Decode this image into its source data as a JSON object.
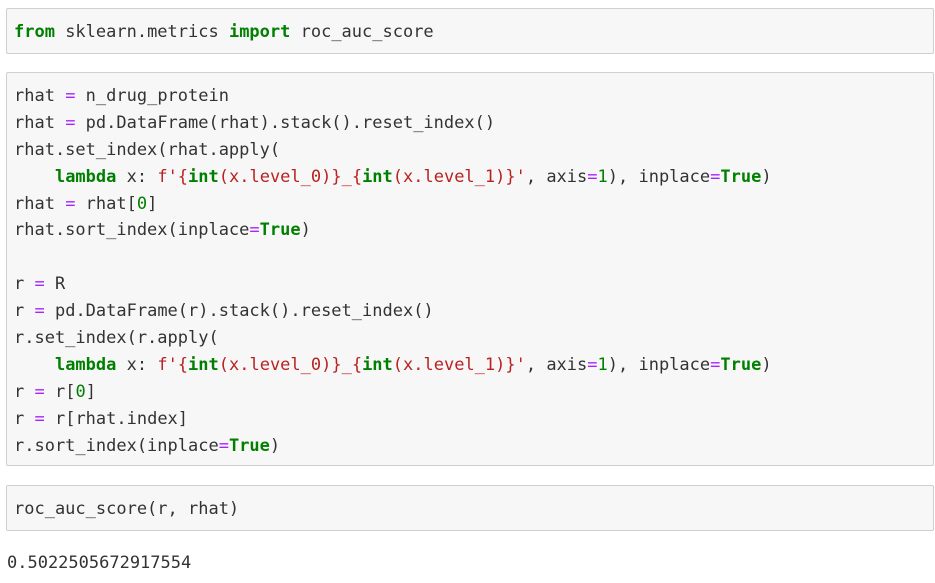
{
  "cells": [
    {
      "name": "code-cell-import",
      "lines": [
        [
          [
            "kw",
            "from"
          ],
          [
            "tk",
            " sklearn.metrics "
          ],
          [
            "kw",
            "import"
          ],
          [
            "tk",
            " roc_auc_score"
          ]
        ]
      ]
    },
    {
      "name": "code-cell-preprocess",
      "lines": [
        [
          [
            "tk",
            "rhat "
          ],
          [
            "op",
            "="
          ],
          [
            "tk",
            " n_drug_protein"
          ]
        ],
        [
          [
            "tk",
            "rhat "
          ],
          [
            "op",
            "="
          ],
          [
            "tk",
            " pd.DataFrame(rhat).stack().reset_index()"
          ]
        ],
        [
          [
            "tk",
            "rhat.set_index(rhat.apply("
          ]
        ],
        [
          [
            "tk",
            "    "
          ],
          [
            "kw",
            "lambda"
          ],
          [
            "tk",
            " x: "
          ],
          [
            "str",
            "f'{"
          ],
          [
            "kw",
            "int"
          ],
          [
            "str",
            "(x.level_0)}_{"
          ],
          [
            "kw",
            "int"
          ],
          [
            "str",
            "(x.level_1)}'"
          ],
          [
            "tk",
            ", axis"
          ],
          [
            "op",
            "="
          ],
          [
            "num",
            "1"
          ],
          [
            "tk",
            "), inplace"
          ],
          [
            "op",
            "="
          ],
          [
            "kw",
            "True"
          ],
          [
            "tk",
            ")"
          ]
        ],
        [
          [
            "tk",
            "rhat "
          ],
          [
            "op",
            "="
          ],
          [
            "tk",
            " rhat["
          ],
          [
            "num",
            "0"
          ],
          [
            "tk",
            "]"
          ]
        ],
        [
          [
            "tk",
            "rhat.sort_index(inplace"
          ],
          [
            "op",
            "="
          ],
          [
            "kw",
            "True"
          ],
          [
            "tk",
            ")"
          ]
        ],
        [
          [
            "tk",
            ""
          ]
        ],
        [
          [
            "tk",
            "r "
          ],
          [
            "op",
            "="
          ],
          [
            "tk",
            " R"
          ]
        ],
        [
          [
            "tk",
            "r "
          ],
          [
            "op",
            "="
          ],
          [
            "tk",
            " pd.DataFrame(r).stack().reset_index()"
          ]
        ],
        [
          [
            "tk",
            "r.set_index(r.apply("
          ]
        ],
        [
          [
            "tk",
            "    "
          ],
          [
            "kw",
            "lambda"
          ],
          [
            "tk",
            " x: "
          ],
          [
            "str",
            "f'{"
          ],
          [
            "kw",
            "int"
          ],
          [
            "str",
            "(x.level_0)}_{"
          ],
          [
            "kw",
            "int"
          ],
          [
            "str",
            "(x.level_1)}'"
          ],
          [
            "tk",
            ", axis"
          ],
          [
            "op",
            "="
          ],
          [
            "num",
            "1"
          ],
          [
            "tk",
            "), inplace"
          ],
          [
            "op",
            "="
          ],
          [
            "kw",
            "True"
          ],
          [
            "tk",
            ")"
          ]
        ],
        [
          [
            "tk",
            "r "
          ],
          [
            "op",
            "="
          ],
          [
            "tk",
            " r["
          ],
          [
            "num",
            "0"
          ],
          [
            "tk",
            "]"
          ]
        ],
        [
          [
            "tk",
            "r "
          ],
          [
            "op",
            "="
          ],
          [
            "tk",
            " r[rhat.index]"
          ]
        ],
        [
          [
            "tk",
            "r.sort_index(inplace"
          ],
          [
            "op",
            "="
          ],
          [
            "kw",
            "True"
          ],
          [
            "tk",
            ")"
          ]
        ]
      ]
    },
    {
      "name": "code-cell-score",
      "lines": [
        [
          [
            "tk",
            "roc_auc_score(r, rhat)"
          ]
        ]
      ]
    }
  ],
  "output": {
    "text": "0.5022505672917554"
  },
  "colors": {
    "keyword": "#008000",
    "operator": "#aa22ff",
    "number": "#008000",
    "string": "#ba2121",
    "text": "#333333",
    "cell_background": "#f7f7f7",
    "cell_border": "#cfcfcf"
  }
}
